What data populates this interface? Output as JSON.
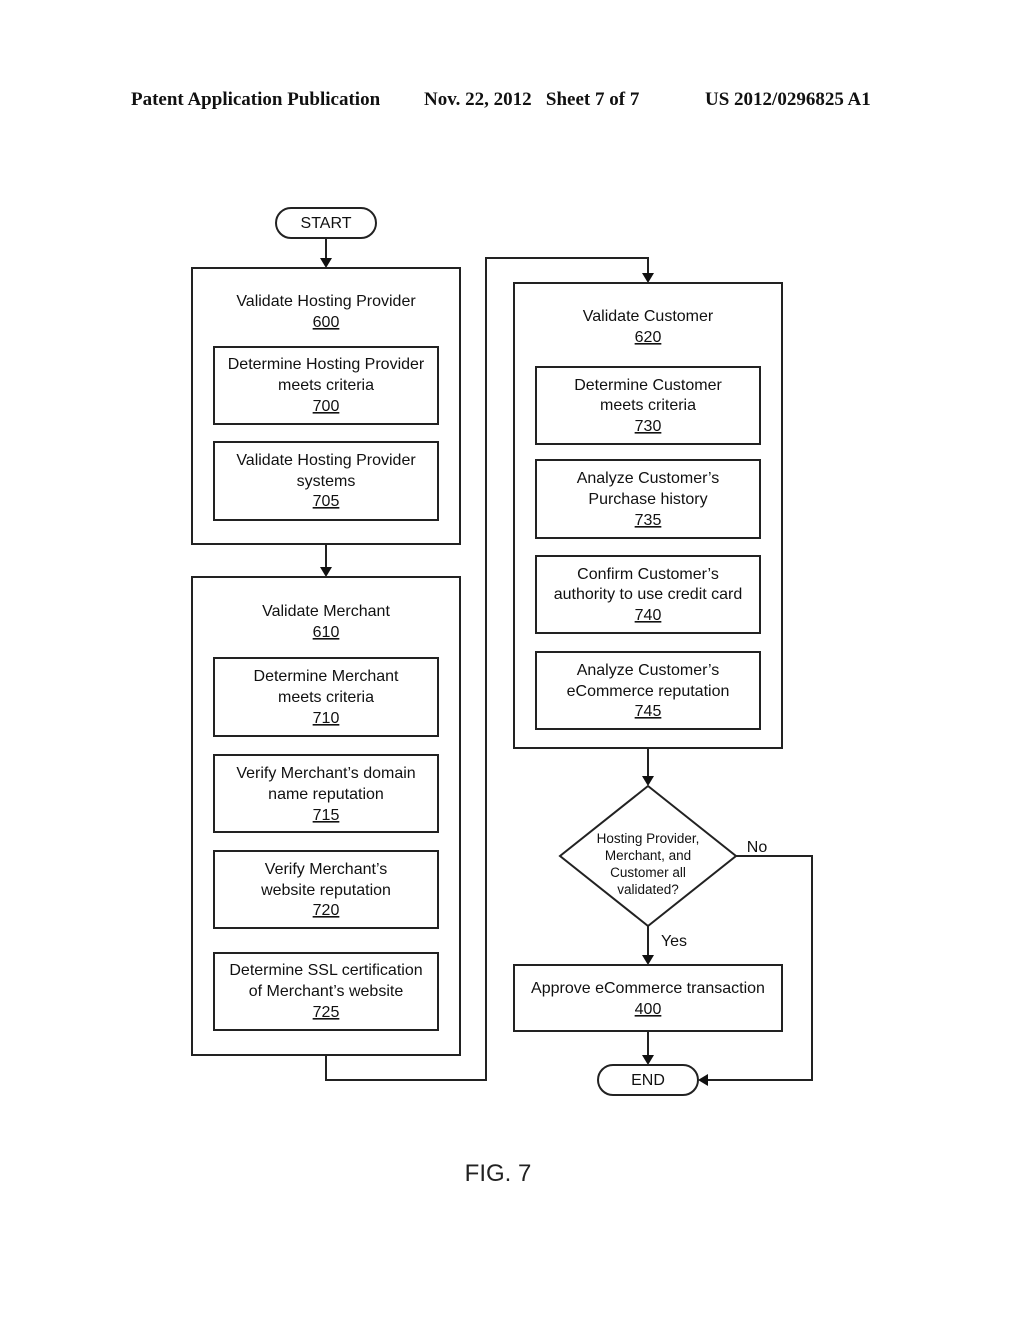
{
  "header": {
    "publication": "Patent Application Publication",
    "date_sheet": "Nov. 22, 2012   Sheet 7 of 7",
    "number": "US 2012/0296825 A1"
  },
  "flowchart": {
    "start": "START",
    "end": "END",
    "groups": [
      {
        "title": "Validate Hosting Provider",
        "ref": "600",
        "steps": [
          {
            "lines": [
              "Determine Hosting Provider",
              "meets criteria"
            ],
            "ref": "700"
          },
          {
            "lines": [
              "Validate Hosting Provider",
              "systems"
            ],
            "ref": "705"
          }
        ]
      },
      {
        "title": "Validate Merchant",
        "ref": "610",
        "steps": [
          {
            "lines": [
              "Determine Merchant",
              "meets criteria"
            ],
            "ref": "710"
          },
          {
            "lines": [
              "Verify Merchant’s domain",
              "name reputation"
            ],
            "ref": "715"
          },
          {
            "lines": [
              "Verify Merchant’s",
              "website reputation"
            ],
            "ref": "720"
          },
          {
            "lines": [
              "Determine SSL certification",
              "of Merchant’s website"
            ],
            "ref": "725"
          }
        ]
      },
      {
        "title": "Validate Customer",
        "ref": "620",
        "steps": [
          {
            "lines": [
              "Determine Customer",
              "meets criteria"
            ],
            "ref": "730"
          },
          {
            "lines": [
              "Analyze Customer’s",
              "Purchase history"
            ],
            "ref": "735"
          },
          {
            "lines": [
              "Confirm Customer’s",
              "authority to use credit card"
            ],
            "ref": "740"
          },
          {
            "lines": [
              "Analyze Customer’s",
              "eCommerce reputation"
            ],
            "ref": "745"
          }
        ]
      }
    ],
    "decision": {
      "lines": [
        "Hosting Provider,",
        "Merchant, and",
        "Customer all",
        "validated?"
      ],
      "yes_label": "Yes",
      "no_label": "No"
    },
    "approve": {
      "title": "Approve eCommerce transaction",
      "ref": "400"
    }
  },
  "figure_label": "FIG. 7"
}
